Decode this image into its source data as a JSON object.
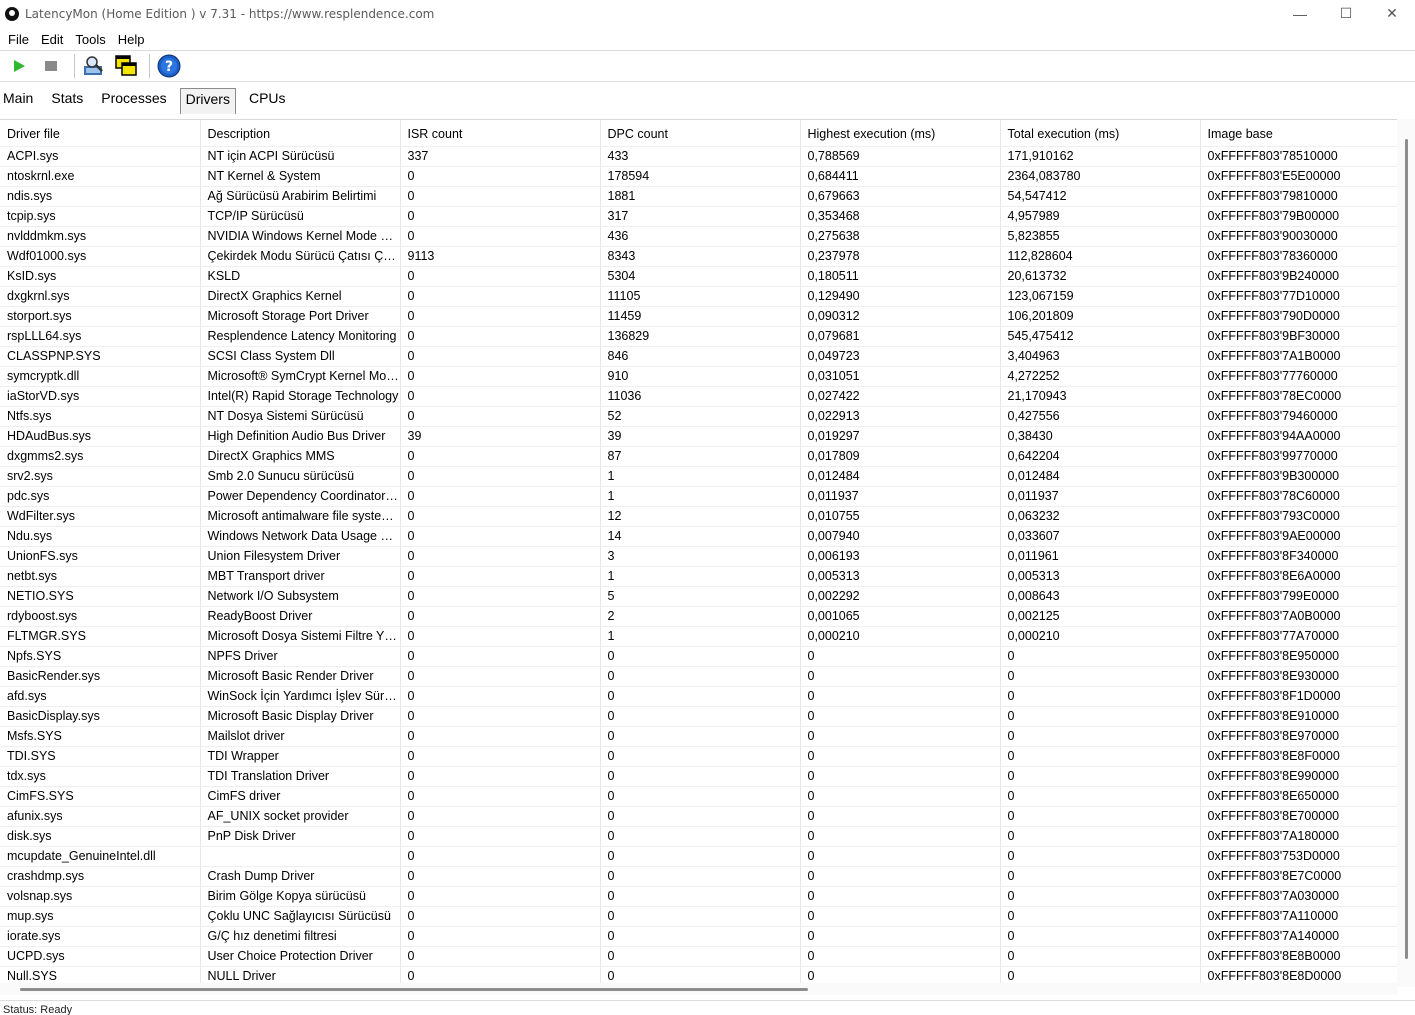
{
  "window": {
    "title": "LatencyMon  (Home Edition )  v 7.31 - https://www.resplendence.com",
    "minimize": "—",
    "maximize": "☐",
    "close": "✕"
  },
  "menu": {
    "file": "File",
    "edit": "Edit",
    "tools": "Tools",
    "help": "Help"
  },
  "tabs": {
    "main": "Main",
    "stats": "Stats",
    "processes": "Processes",
    "drivers": "Drivers",
    "cpus": "CPUs"
  },
  "table": {
    "headers": [
      "Driver file",
      "Description",
      "ISR count",
      "DPC count",
      "Highest execution (ms)",
      "Total execution (ms)",
      "Image base"
    ],
    "rows": [
      [
        "ACPI.sys",
        "NT için ACPI Sürücüsü",
        "337",
        "433",
        "0,788569",
        "171,910162",
        "0xFFFFF803'78510000"
      ],
      [
        "ntoskrnl.exe",
        "NT Kernel & System",
        "0",
        "178594",
        "0,684411",
        "2364,083780",
        "0xFFFFF803'E5E00000"
      ],
      [
        "ndis.sys",
        "Ağ Sürücüsü Arabirim Belirtimi",
        "0",
        "1881",
        "0,679663",
        "54,547412",
        "0xFFFFF803'79810000"
      ],
      [
        "tcpip.sys",
        "TCP/IP Sürücüsü",
        "0",
        "317",
        "0,353468",
        "4,957989",
        "0xFFFFF803'79B00000"
      ],
      [
        "nvlddmkm.sys",
        "NVIDIA Windows Kernel Mode Driver",
        "0",
        "436",
        "0,275638",
        "5,823855",
        "0xFFFFF803'90030000"
      ],
      [
        "Wdf01000.sys",
        "Çekirdek Modu Sürücü Çatısı Çalışma Zamanı",
        "9113",
        "8343",
        "0,237978",
        "112,828604",
        "0xFFFFF803'78360000"
      ],
      [
        "KsID.sys",
        "KSLD",
        "0",
        "5304",
        "0,180511",
        "20,613732",
        "0xFFFFF803'9B240000"
      ],
      [
        "dxgkrnl.sys",
        "DirectX Graphics Kernel",
        "0",
        "11105",
        "0,129490",
        "123,067159",
        "0xFFFFF803'77D10000"
      ],
      [
        "storport.sys",
        "Microsoft Storage Port Driver",
        "0",
        "11459",
        "0,090312",
        "106,201809",
        "0xFFFFF803'790D0000"
      ],
      [
        "rspLLL64.sys",
        "Resplendence Latency Monitoring",
        "0",
        "136829",
        "0,079681",
        "545,475412",
        "0xFFFFF803'9BF30000"
      ],
      [
        "CLASSPNP.SYS",
        "SCSI Class System Dll",
        "0",
        "846",
        "0,049723",
        "3,404963",
        "0xFFFFF803'7A1B0000"
      ],
      [
        "symcryptk.dll",
        "Microsoft® SymCrypt Kernel Module",
        "0",
        "910",
        "0,031051",
        "4,272252",
        "0xFFFFF803'77760000"
      ],
      [
        "iaStorVD.sys",
        "Intel(R) Rapid Storage Technology",
        "0",
        "11036",
        "0,027422",
        "21,170943",
        "0xFFFFF803'78EC0000"
      ],
      [
        "Ntfs.sys",
        "NT Dosya Sistemi Sürücüsü",
        "0",
        "52",
        "0,022913",
        "0,427556",
        "0xFFFFF803'79460000"
      ],
      [
        "HDAudBus.sys",
        "High Definition Audio Bus Driver",
        "39",
        "39",
        "0,019297",
        "0,38430",
        "0xFFFFF803'94AA0000"
      ],
      [
        "dxgmms2.sys",
        "DirectX Graphics MMS",
        "0",
        "87",
        "0,017809",
        "0,642204",
        "0xFFFFF803'99770000"
      ],
      [
        "srv2.sys",
        "Smb 2.0 Sunucu sürücüsü",
        "0",
        "1",
        "0,012484",
        "0,012484",
        "0xFFFFF803'9B300000"
      ],
      [
        "pdc.sys",
        "Power Dependency Coordinator Driver",
        "0",
        "1",
        "0,011937",
        "0,011937",
        "0xFFFFF803'78C60000"
      ],
      [
        "WdFilter.sys",
        "Microsoft antimalware file system filter driver",
        "0",
        "12",
        "0,010755",
        "0,063232",
        "0xFFFFF803'793C0000"
      ],
      [
        "Ndu.sys",
        "Windows Network Data Usage Monitoring Driver",
        "0",
        "14",
        "0,007940",
        "0,033607",
        "0xFFFFF803'9AE00000"
      ],
      [
        "UnionFS.sys",
        "Union Filesystem Driver",
        "0",
        "3",
        "0,006193",
        "0,011961",
        "0xFFFFF803'8F340000"
      ],
      [
        "netbt.sys",
        "MBT Transport driver",
        "0",
        "1",
        "0,005313",
        "0,005313",
        "0xFFFFF803'8E6A0000"
      ],
      [
        "NETIO.SYS",
        "Network I/O Subsystem",
        "0",
        "5",
        "0,002292",
        "0,008643",
        "0xFFFFF803'799E0000"
      ],
      [
        "rdyboost.sys",
        "ReadyBoost Driver",
        "0",
        "2",
        "0,001065",
        "0,002125",
        "0xFFFFF803'7A0B0000"
      ],
      [
        "FLTMGR.SYS",
        "Microsoft Dosya Sistemi Filtre Yöneticisi",
        "0",
        "1",
        "0,000210",
        "0,000210",
        "0xFFFFF803'77A70000"
      ],
      [
        "Npfs.SYS",
        "NPFS Driver",
        "0",
        "0",
        "0",
        "0",
        "0xFFFFF803'8E950000"
      ],
      [
        "BasicRender.sys",
        "Microsoft Basic Render Driver",
        "0",
        "0",
        "0",
        "0",
        "0xFFFFF803'8E930000"
      ],
      [
        "afd.sys",
        "WinSock İçin Yardımcı İşlev Sürücüsü",
        "0",
        "0",
        "0",
        "0",
        "0xFFFFF803'8F1D0000"
      ],
      [
        "BasicDisplay.sys",
        "Microsoft Basic Display Driver",
        "0",
        "0",
        "0",
        "0",
        "0xFFFFF803'8E910000"
      ],
      [
        "Msfs.SYS",
        "Mailslot driver",
        "0",
        "0",
        "0",
        "0",
        "0xFFFFF803'8E970000"
      ],
      [
        "TDI.SYS",
        "TDI Wrapper",
        "0",
        "0",
        "0",
        "0",
        "0xFFFFF803'8E8F0000"
      ],
      [
        "tdx.sys",
        "TDI Translation Driver",
        "0",
        "0",
        "0",
        "0",
        "0xFFFFF803'8E990000"
      ],
      [
        "CimFS.SYS",
        "CimFS driver",
        "0",
        "0",
        "0",
        "0",
        "0xFFFFF803'8E650000"
      ],
      [
        "afunix.sys",
        "AF_UNIX socket provider",
        "0",
        "0",
        "0",
        "0",
        "0xFFFFF803'8E700000"
      ],
      [
        "disk.sys",
        "PnP Disk Driver",
        "0",
        "0",
        "0",
        "0",
        "0xFFFFF803'7A180000"
      ],
      [
        "mcupdate_GenuineIntel.dll",
        "",
        "0",
        "0",
        "0",
        "0",
        "0xFFFFF803'753D0000"
      ],
      [
        "crashdmp.sys",
        "Crash Dump Driver",
        "0",
        "0",
        "0",
        "0",
        "0xFFFFF803'8E7C0000"
      ],
      [
        "volsnap.sys",
        "Birim Gölge Kopya sürücüsü",
        "0",
        "0",
        "0",
        "0",
        "0xFFFFF803'7A030000"
      ],
      [
        "mup.sys",
        "Çoklu UNC Sağlayıcısı Sürücüsü",
        "0",
        "0",
        "0",
        "0",
        "0xFFFFF803'7A110000"
      ],
      [
        "iorate.sys",
        "G/Ç hız denetimi filtresi",
        "0",
        "0",
        "0",
        "0",
        "0xFFFFF803'7A140000"
      ],
      [
        "UCPD.sys",
        "User Choice Protection Driver",
        "0",
        "0",
        "0",
        "0",
        "0xFFFFF803'8E8B0000"
      ],
      [
        "Null.SYS",
        "NULL Driver",
        "0",
        "0",
        "0",
        "0",
        "0xFFFFF803'8E8D0000"
      ]
    ]
  },
  "statusbar": {
    "text": "Status: Ready"
  },
  "colors": {
    "play": "#2db82d",
    "stop": "#8a8a8a",
    "help": "#1c5fc8"
  }
}
